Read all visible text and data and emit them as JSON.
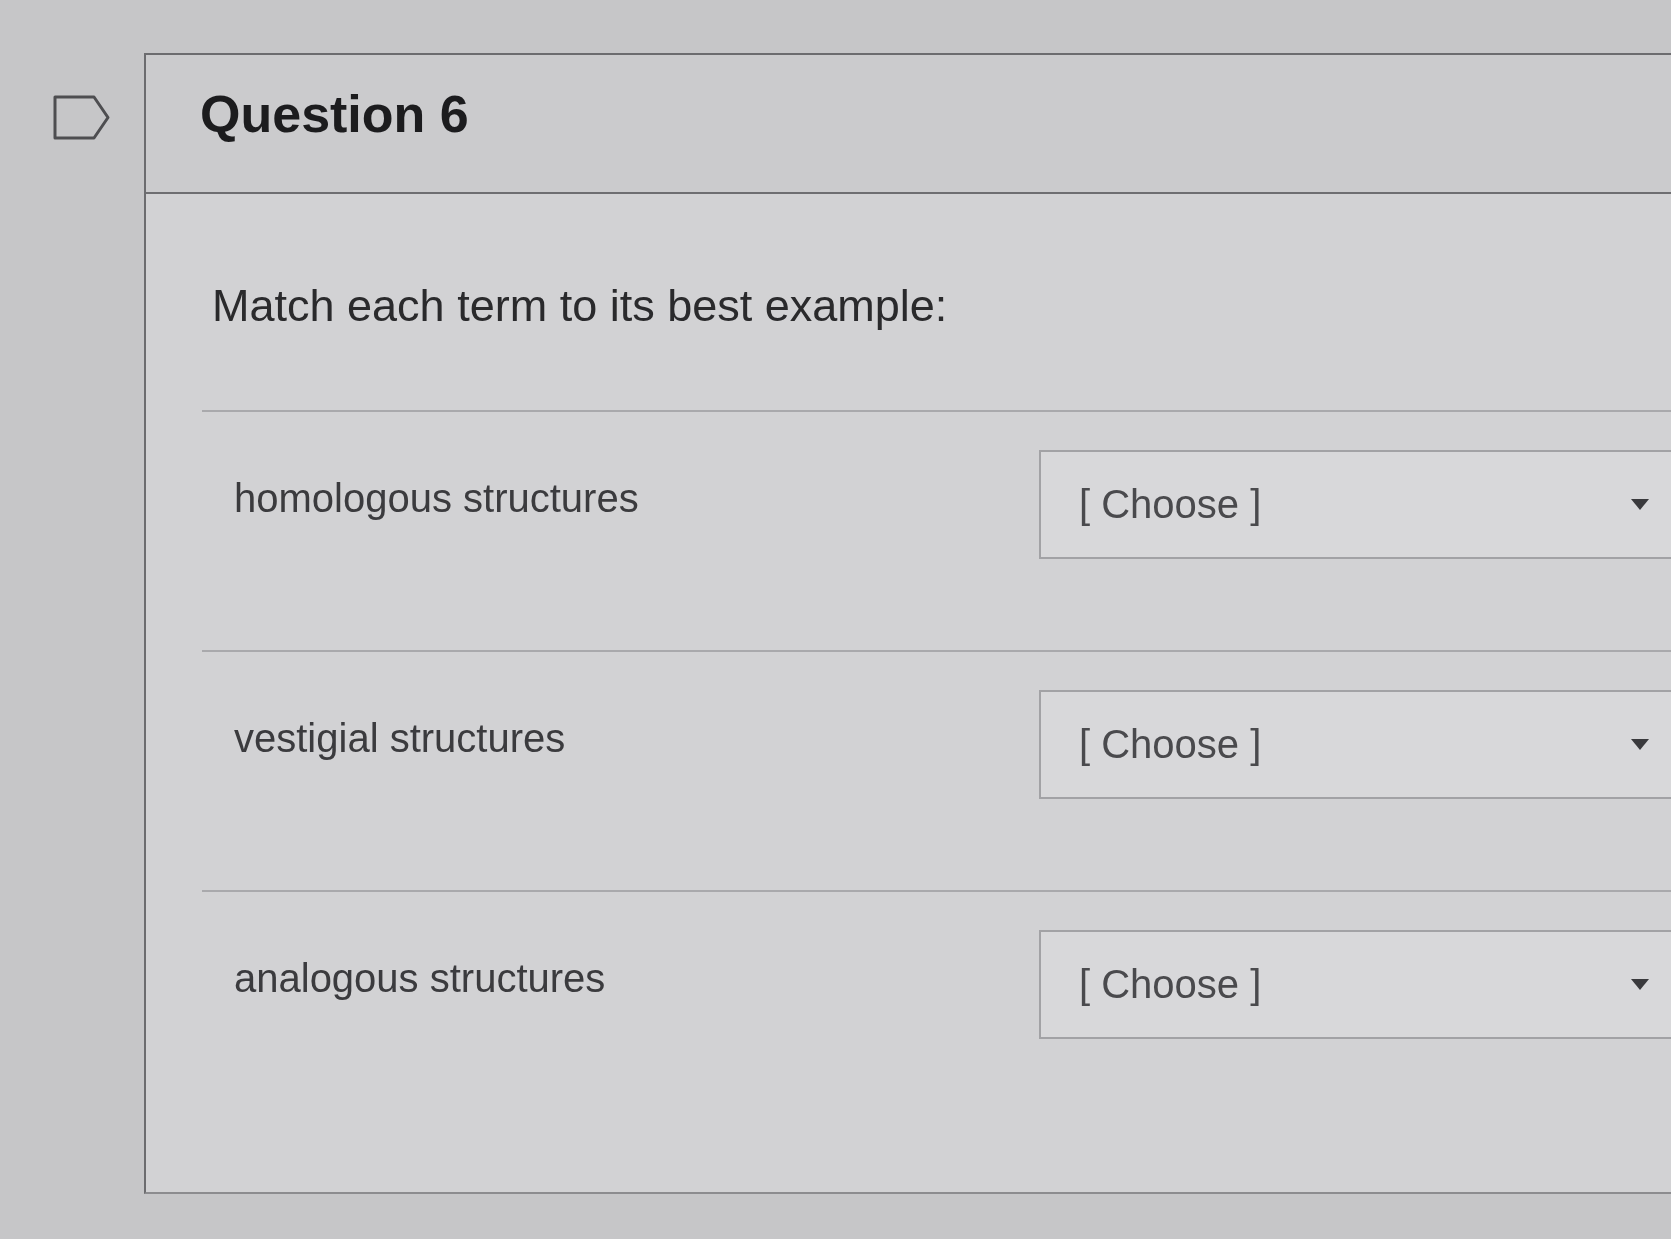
{
  "question": {
    "title": "Question 6",
    "prompt": "Match each term to its best example:",
    "matches": [
      {
        "term": "homologous structures",
        "value": "[ Choose ]"
      },
      {
        "term": "vestigial structures",
        "value": "[ Choose ]"
      },
      {
        "term": "analogous structures",
        "value": "[ Choose ]"
      }
    ]
  }
}
